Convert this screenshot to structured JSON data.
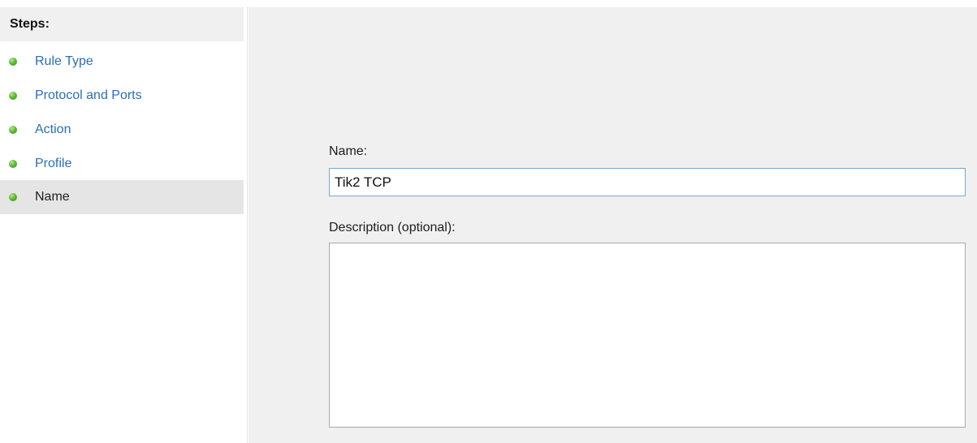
{
  "sidebar": {
    "header": "Steps:",
    "items": [
      {
        "label": "Rule Type",
        "status": "complete"
      },
      {
        "label": "Protocol and Ports",
        "status": "complete"
      },
      {
        "label": "Action",
        "status": "complete"
      },
      {
        "label": "Profile",
        "status": "complete"
      },
      {
        "label": "Name",
        "status": "current"
      }
    ]
  },
  "form": {
    "name_label": "Name:",
    "name_value": "Tik2 TCP",
    "description_label": "Description (optional):",
    "description_value": ""
  },
  "colors": {
    "link": "#2a6eb8",
    "step_dot": "#5fbb35",
    "panel_bg": "#f0f0f0",
    "selected_step_bg": "#e5e5e5",
    "input_focus_border": "#7fa6c8"
  }
}
